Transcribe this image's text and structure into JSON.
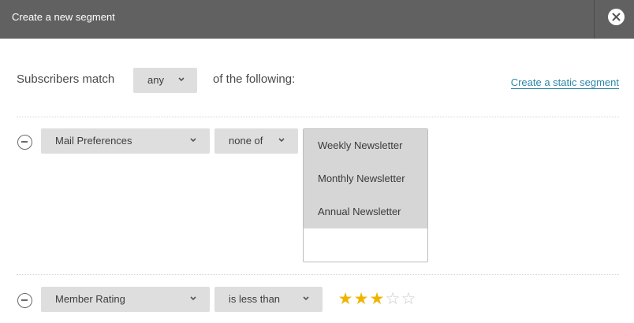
{
  "dialog": {
    "title": "Create a new segment",
    "close_icon": "close-icon"
  },
  "match": {
    "prefix": "Subscribers match",
    "selected": "any",
    "suffix": "of the following:",
    "static_link": "Create a static segment"
  },
  "conditions": [
    {
      "field": "Mail Preferences",
      "operator": "none of",
      "options": [
        "Weekly Newsletter",
        "Monthly Newsletter",
        "Annual Newsletter"
      ]
    },
    {
      "field": "Member Rating",
      "operator": "is less than",
      "rating": {
        "value": 3,
        "max": 5
      }
    }
  ],
  "colors": {
    "titlebar": "#616161",
    "link": "#2d88a8",
    "star_on": "#f0b400",
    "star_off": "#c8c8c8",
    "control": "#dedede"
  }
}
